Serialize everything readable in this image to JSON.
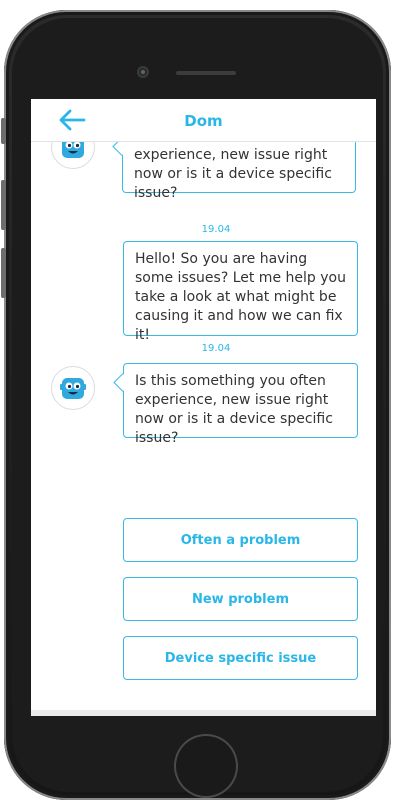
{
  "header": {
    "title": "Dom",
    "back_icon": "arrow-left-icon"
  },
  "messages": [
    {
      "text": "experience, new issue right now or is it a device specific issue?"
    },
    {
      "time": "19.04",
      "text": "Hello! So you are having some issues? Let me help you take a look at what might be causing it and how we can fix it!"
    },
    {
      "time": "19.04",
      "text": "Is this something you often experience, new issue right now or is it a device specific issue?"
    }
  ],
  "quick_replies": [
    "Often a problem",
    "New problem",
    "Device specific issue"
  ],
  "colors": {
    "accent": "#29b6e8",
    "bubble_border": "#39b9e6",
    "phone": "#1c1c1c"
  }
}
